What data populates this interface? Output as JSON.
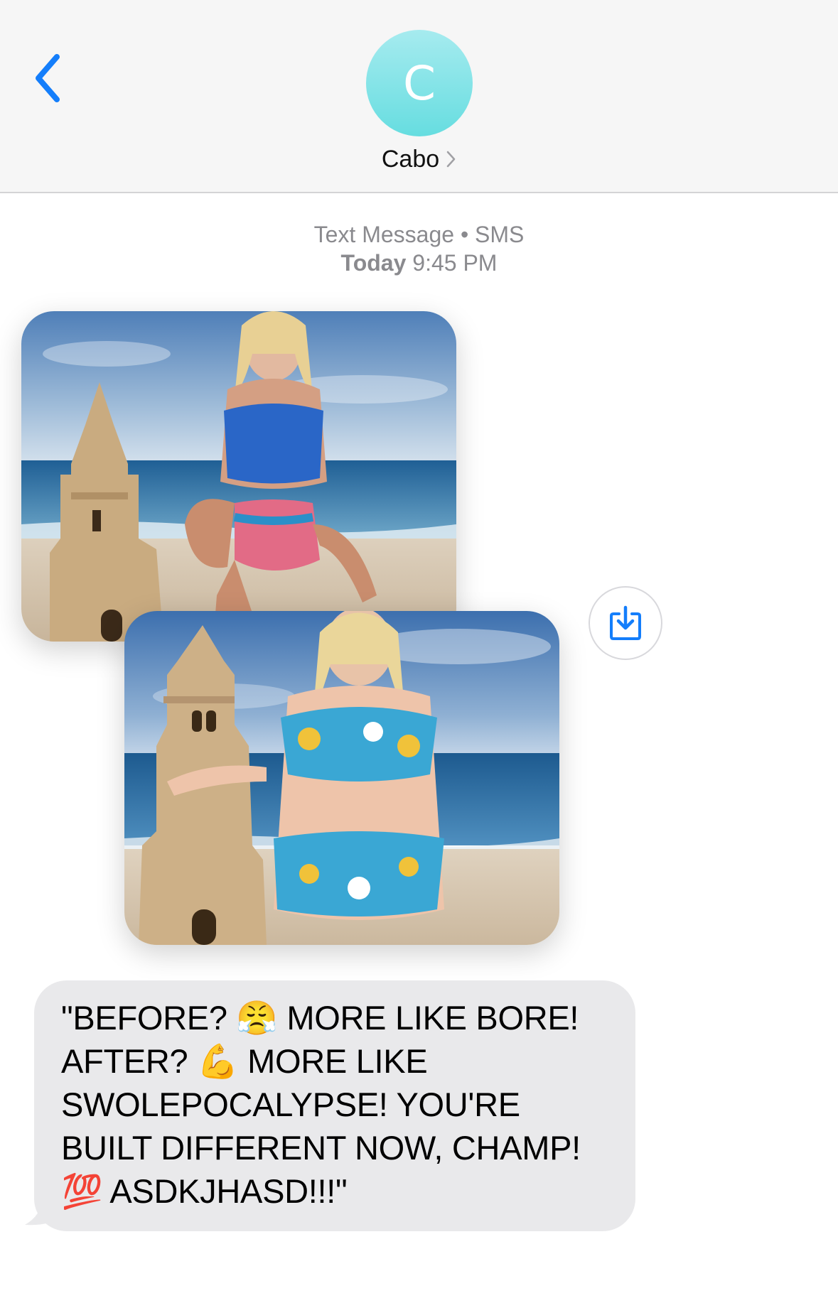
{
  "header": {
    "avatar_letter": "C",
    "contact_name": "Cabo",
    "accent": "#147efb"
  },
  "meta": {
    "service": "Text Message • SMS",
    "day": "Today",
    "time": "9:45 PM"
  },
  "photos": [
    {
      "description": "beach-sandcastle-athletic-woman-photo"
    },
    {
      "description": "beach-sandcastle-woman-photo"
    }
  ],
  "message": {
    "text": "\"BEFORE? 😤 MORE LIKE BORE! AFTER? 💪 MORE LIKE SWOLEPOCALYPSE! YOU'RE BUILT DIFFERENT NOW, CHAMP! 💯 ASDKJHASD!!!\""
  }
}
